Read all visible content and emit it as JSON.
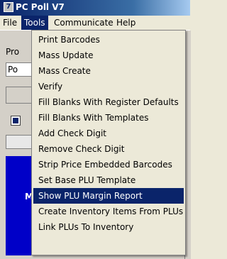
{
  "window": {
    "title": "PC Poll V7"
  },
  "menubar": [
    {
      "label": "File"
    },
    {
      "label": "Tools"
    },
    {
      "label": "Communicate"
    },
    {
      "label": "Help"
    }
  ],
  "background": {
    "label_partial": "Pro",
    "field_partial": "Po",
    "blue_panel_letter": "M"
  },
  "tools_menu": {
    "items": [
      {
        "label": "Print Barcodes"
      },
      {
        "label": "Mass Update"
      },
      {
        "label": "Mass Create"
      },
      {
        "label": "Verify"
      },
      {
        "label": "Fill Blanks With Register Defaults"
      },
      {
        "label": "Fill Blanks With Templates"
      },
      {
        "label": "Add Check Digit"
      },
      {
        "label": "Remove Check Digit"
      },
      {
        "label": "Strip Price Embedded Barcodes"
      },
      {
        "label": "Set Base PLU Template"
      },
      {
        "label": "Show PLU Margin Report"
      },
      {
        "label": "Create Inventory Items From PLUs"
      },
      {
        "label": "Link PLUs To Inventory"
      }
    ],
    "highlighted_index": 10
  },
  "colors": {
    "highlight": "#0a246a",
    "menu_bg": "#ece9d8",
    "panel_blue": "#0000c8"
  }
}
